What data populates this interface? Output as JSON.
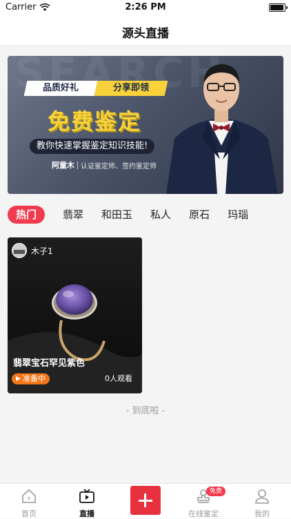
{
  "status_bar": {
    "carrier": "Carrier",
    "time": "2:26 PM"
  },
  "nav": {
    "title": "源头直播"
  },
  "banner": {
    "watermark": "SEARCH",
    "tag_left": "品质好礼",
    "tag_right": "分享即领",
    "headline": "免费鉴定",
    "slogan": "教你快速掌握鉴定知识技能!",
    "author_name": "阿童木",
    "author_title": "认证鉴定师、签约鉴定师"
  },
  "tabs": [
    {
      "label": "热门",
      "active": true
    },
    {
      "label": "翡翠"
    },
    {
      "label": "和田玉"
    },
    {
      "label": "私人"
    },
    {
      "label": "原石"
    },
    {
      "label": "玛瑙"
    }
  ],
  "live_card": {
    "username": "木子1",
    "title": "翡翠宝石罕见紫色",
    "status": "准备中",
    "viewers": "0人观看"
  },
  "end_text": "- 到底啦 -",
  "tab_bar": {
    "items": [
      {
        "label": "首页",
        "icon": "home-icon"
      },
      {
        "label": "直播",
        "icon": "live-tv-icon",
        "active": true
      },
      {
        "label": "",
        "icon": "plus-icon"
      },
      {
        "label": "在线鉴定",
        "icon": "stamp-icon"
      },
      {
        "label": "我的",
        "icon": "profile-icon"
      }
    ],
    "badge": "免费"
  },
  "colors": {
    "accent": "#f03a4d",
    "status_orange": "#f5761a",
    "banner_gold": "#f7d23b"
  }
}
